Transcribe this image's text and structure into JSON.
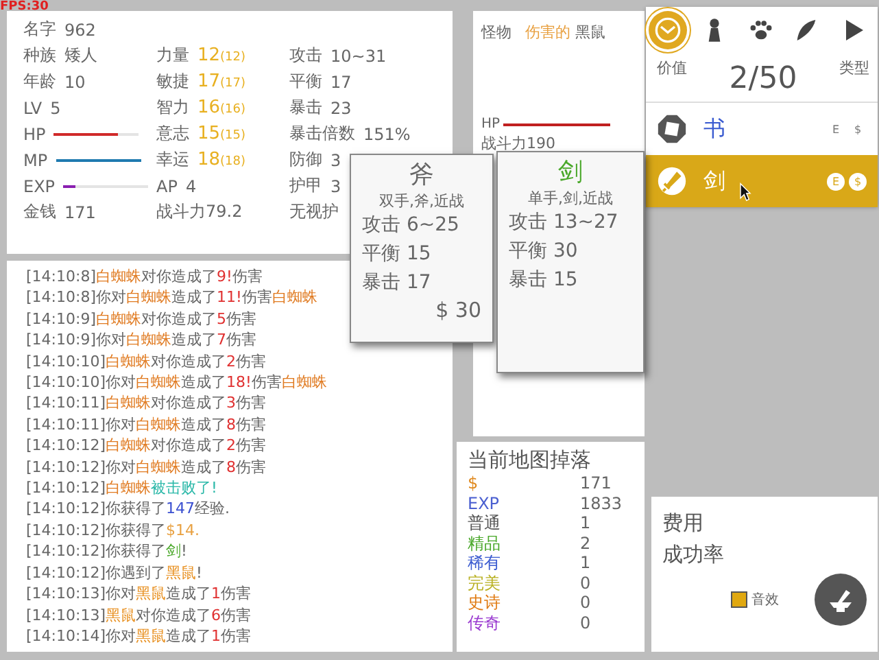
{
  "fps": "FPS:30",
  "stats": {
    "columns": [
      [
        {
          "kind": "text",
          "label": "名字",
          "value": "962"
        },
        {
          "kind": "text",
          "label": "种族",
          "value": "矮人"
        },
        {
          "kind": "text",
          "label": "年龄",
          "value": "10"
        },
        {
          "kind": "text",
          "label": "LV",
          "value": "5"
        },
        {
          "kind": "bar",
          "label": "HP",
          "level": 0.75,
          "color": "#d02a2a"
        },
        {
          "kind": "bar",
          "label": "MP",
          "level": 1.0,
          "color": "#1f7ab0"
        },
        {
          "kind": "bar",
          "label": "EXP",
          "level": 0.15,
          "color": "#8a1fb0"
        },
        {
          "kind": "text",
          "label": "金钱",
          "value": "171"
        }
      ],
      [
        {
          "kind": "attr",
          "label": "力量",
          "value": "12",
          "base": "(12)"
        },
        {
          "kind": "attr",
          "label": "敏捷",
          "value": "17",
          "base": "(17)"
        },
        {
          "kind": "attr",
          "label": "智力",
          "value": "16",
          "base": "(16)"
        },
        {
          "kind": "attr",
          "label": "意志",
          "value": "15",
          "base": "(15)"
        },
        {
          "kind": "attr",
          "label": "幸运",
          "value": "18",
          "base": "(18)"
        },
        {
          "kind": "text",
          "label": "AP",
          "value": "4"
        },
        {
          "kind": "text",
          "label": "战斗力79.2"
        }
      ],
      [
        {
          "kind": "text",
          "label": "攻击",
          "value": "10~31"
        },
        {
          "kind": "text",
          "label": "平衡",
          "value": "17"
        },
        {
          "kind": "text",
          "label": "暴击",
          "value": "23"
        },
        {
          "kind": "text",
          "label": "暴击倍数",
          "value": "151%"
        },
        {
          "kind": "text",
          "label": "防御",
          "value": "3"
        },
        {
          "kind": "text",
          "label": "护甲",
          "value": "3"
        },
        {
          "kind": "text",
          "label": "无视护"
        }
      ]
    ]
  },
  "monster": {
    "label": "怪物",
    "prefix": "伤害的",
    "name": "黑鼠",
    "hp_label": "HP",
    "hp": {
      "level": 1.0
    },
    "power": "战斗力190"
  },
  "inventory": {
    "tabs": [
      {
        "selected": true
      },
      {
        "selected": false
      },
      {
        "selected": false
      },
      {
        "selected": false
      },
      {
        "selected": false
      }
    ],
    "sort_value": "价值",
    "count": "2/50",
    "sort_type": "类型",
    "items": [
      {
        "name": "书",
        "color": "#3a5bd0",
        "selected": false,
        "equip": "E",
        "sell": "$"
      },
      {
        "name": "剑",
        "color": "#ffffff",
        "selected": true,
        "equip": "E",
        "sell": "$"
      }
    ]
  },
  "tooltips": [
    {
      "title": "斧",
      "color": "#666666",
      "subtitle": "双手,斧,近战",
      "stats": [
        "攻击 6~25",
        "平衡 15",
        "暴击 17"
      ],
      "price": "$ 30"
    },
    {
      "title": "剑",
      "color": "#4aa82a",
      "subtitle": "单手,剑,近战",
      "stats": [
        "攻击 13~27",
        "平衡 30",
        "暴击 15"
      ]
    }
  ],
  "log": [
    [
      {
        "text": "[14:10:8]"
      },
      {
        "text": "白蜘蛛",
        "color": "#e07a20"
      },
      {
        "text": "对你造成了"
      },
      {
        "text": "9!",
        "color": "#e03030"
      },
      {
        "text": "伤害"
      }
    ],
    [
      {
        "text": "[14:10:8]你对"
      },
      {
        "text": "白蜘蛛",
        "color": "#e07a20"
      },
      {
        "text": "造成了"
      },
      {
        "text": "11!",
        "color": "#e03030"
      },
      {
        "text": "伤害"
      },
      {
        "text": "白蜘蛛",
        "color": "#e07a20"
      }
    ],
    [
      {
        "text": "[14:10:9]"
      },
      {
        "text": "白蜘蛛",
        "color": "#e07a20"
      },
      {
        "text": "对你造成了"
      },
      {
        "text": "5",
        "color": "#e03030"
      },
      {
        "text": "伤害"
      }
    ],
    [
      {
        "text": "[14:10:9]你对"
      },
      {
        "text": "白蜘蛛",
        "color": "#e07a20"
      },
      {
        "text": "造成了"
      },
      {
        "text": "7",
        "color": "#e03030"
      },
      {
        "text": "伤害"
      }
    ],
    [
      {
        "text": "[14:10:10]"
      },
      {
        "text": "白蜘蛛",
        "color": "#e07a20"
      },
      {
        "text": "对你造成了"
      },
      {
        "text": "2",
        "color": "#e03030"
      },
      {
        "text": "伤害"
      }
    ],
    [
      {
        "text": "[14:10:10]你对"
      },
      {
        "text": "白蜘蛛",
        "color": "#e07a20"
      },
      {
        "text": "造成了"
      },
      {
        "text": "18!",
        "color": "#e03030"
      },
      {
        "text": "伤害"
      },
      {
        "text": "白蜘蛛",
        "color": "#e07a20"
      }
    ],
    [
      {
        "text": "[14:10:11]"
      },
      {
        "text": "白蜘蛛",
        "color": "#e07a20"
      },
      {
        "text": "对你造成了"
      },
      {
        "text": "3",
        "color": "#e03030"
      },
      {
        "text": "伤害"
      }
    ],
    [
      {
        "text": "[14:10:11]你对"
      },
      {
        "text": "白蜘蛛",
        "color": "#e07a20"
      },
      {
        "text": "造成了"
      },
      {
        "text": "8",
        "color": "#e03030"
      },
      {
        "text": "伤害"
      }
    ],
    [
      {
        "text": "[14:10:12]"
      },
      {
        "text": "白蜘蛛",
        "color": "#e07a20"
      },
      {
        "text": "对你造成了"
      },
      {
        "text": "2",
        "color": "#e03030"
      },
      {
        "text": "伤害"
      }
    ],
    [
      {
        "text": "[14:10:12]你对"
      },
      {
        "text": "白蜘蛛",
        "color": "#e07a20"
      },
      {
        "text": "造成了"
      },
      {
        "text": "8",
        "color": "#e03030"
      },
      {
        "text": "伤害"
      }
    ],
    [
      {
        "text": "[14:10:12]"
      },
      {
        "text": "白蜘蛛",
        "color": "#e07a20"
      },
      {
        "text": "被击败了!",
        "color": "#2ab8a8"
      }
    ],
    [
      {
        "text": "[14:10:12]你获得了"
      },
      {
        "text": "147",
        "color": "#3a4fd0"
      },
      {
        "text": "经验."
      }
    ],
    [
      {
        "text": "[14:10:12]你获得了"
      },
      {
        "text": "$14.",
        "color": "#e8a040"
      }
    ],
    [
      {
        "text": "[14:10:12]你获得了"
      },
      {
        "text": "剑",
        "color": "#4aa82a"
      },
      {
        "text": "!"
      }
    ],
    [
      {
        "text": "[14:10:12]你遇到了"
      },
      {
        "text": "黑鼠",
        "color": "#e89020"
      },
      {
        "text": "!"
      }
    ],
    [
      {
        "text": "[14:10:13]你对"
      },
      {
        "text": "黑鼠",
        "color": "#e89020"
      },
      {
        "text": "造成了"
      },
      {
        "text": "1",
        "color": "#e03030"
      },
      {
        "text": "伤害"
      }
    ],
    [
      {
        "text": "[14:10:13]"
      },
      {
        "text": "黑鼠",
        "color": "#e89020"
      },
      {
        "text": "对你造成了"
      },
      {
        "text": "6",
        "color": "#e03030"
      },
      {
        "text": "伤害"
      }
    ],
    [
      {
        "text": "[14:10:14]你对"
      },
      {
        "text": "黑鼠",
        "color": "#e89020"
      },
      {
        "text": "造成了"
      },
      {
        "text": "1",
        "color": "#e03030"
      },
      {
        "text": "伤害"
      }
    ]
  ],
  "drops": {
    "title": "当前地图掉落",
    "rows": [
      {
        "label": "$",
        "value": "171",
        "color": "#e08a20"
      },
      {
        "label": "EXP",
        "value": "1833",
        "color": "#4a5fd0"
      },
      {
        "label": "普通",
        "value": "1",
        "color": "#555555"
      },
      {
        "label": "精品",
        "value": "2",
        "color": "#4aa82a"
      },
      {
        "label": "稀有",
        "value": "1",
        "color": "#3a5bd0"
      },
      {
        "label": "完美",
        "value": "0",
        "color": "#b8b020"
      },
      {
        "label": "史诗",
        "value": "0",
        "color": "#e07a10"
      },
      {
        "label": "传奇",
        "value": "0",
        "color": "#9a3ad0"
      }
    ]
  },
  "craft": {
    "cost": "费用",
    "rate": "成功率",
    "sound": {
      "label": "音效",
      "checked": true
    }
  }
}
